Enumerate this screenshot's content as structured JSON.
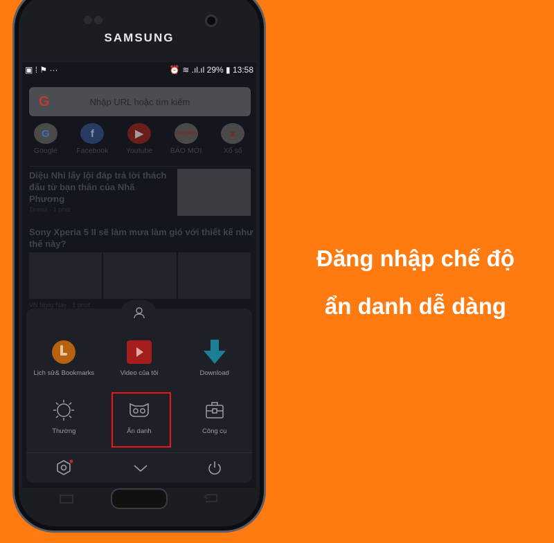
{
  "phone": {
    "brand": "SAMSUNG"
  },
  "status": {
    "battery": "29%",
    "time": "13:58",
    "dots": "···"
  },
  "search": {
    "placeholder": "Nhập URL hoặc tìm kiếm",
    "logo": "G"
  },
  "quick_links": [
    {
      "label": "Google",
      "glyph": "G",
      "color": "#4a4a4a",
      "fg": "#3b6fb6"
    },
    {
      "label": "Facebook",
      "glyph": "f",
      "color": "#283c63",
      "fg": "#8a96ad"
    },
    {
      "label": "Youtube",
      "glyph": "▶",
      "color": "#6b1d1a",
      "fg": "#9e9e9e"
    },
    {
      "label": "BÁO MỚI",
      "glyph": "BÁO MỚI",
      "color": "#4a4a4a",
      "fg": "#7a2a22"
    },
    {
      "label": "Xổ số",
      "glyph": "x",
      "color": "#4a4a4a",
      "fg": "#7a2a22"
    }
  ],
  "news": [
    {
      "title": "Diệu Nhi lấy lội đáp trả lời thách đấu từ bạn thân của Nhã Phương",
      "source": "Tinmoi",
      "time": "1 phút"
    },
    {
      "title": "Sony Xperia 5 II sẽ làm mưa làm gió với thiết kế như thế này?",
      "source": "VN Ngày Nay",
      "time": "1 phút"
    }
  ],
  "menu": {
    "items": [
      {
        "label": "Lịch sử& Bookmarks",
        "icon": "clock-icon",
        "color": "#b8620f"
      },
      {
        "label": "Video của tôi",
        "icon": "video-icon",
        "color": "#a51d1d"
      },
      {
        "label": "Download",
        "icon": "download-icon",
        "color": "#1d7f94"
      },
      {
        "label": "Thường",
        "icon": "sun-icon"
      },
      {
        "label": "Ẩn danh",
        "icon": "incognito-mask-icon",
        "highlighted": true
      },
      {
        "label": "Công cụ",
        "icon": "toolbox-icon"
      }
    ]
  },
  "caption": {
    "line1": "Đăng nhập chế độ",
    "line2": "ẩn danh dễ dàng"
  },
  "colors": {
    "background": "#FF7B12",
    "highlight": "#F2161A"
  }
}
